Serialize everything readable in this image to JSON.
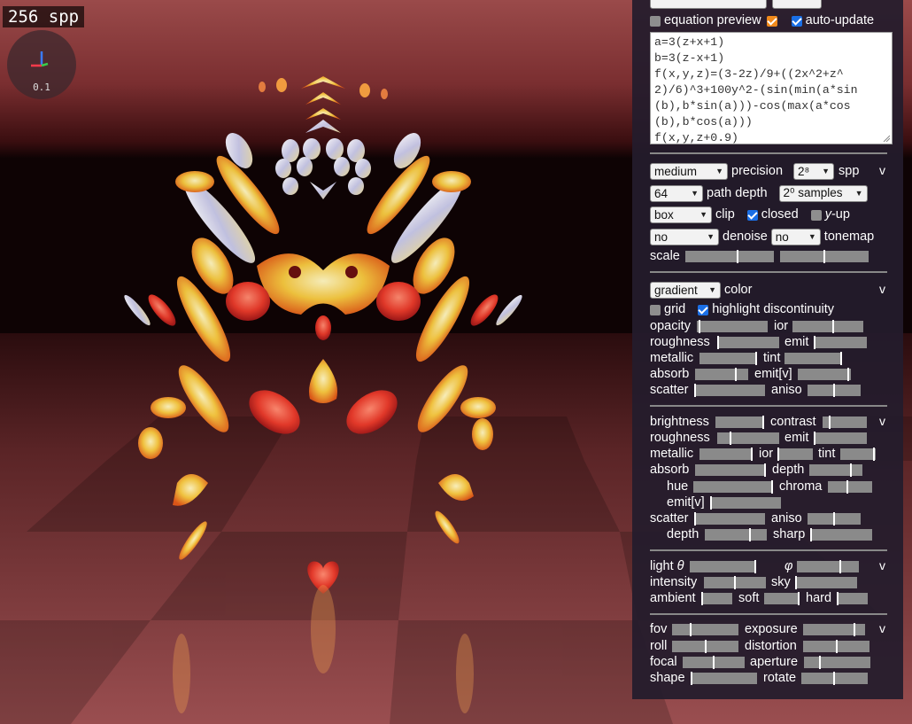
{
  "spp_display": "256 spp",
  "gizmo": {
    "scale": "0.1",
    "icon": "axis-gizmo-icon"
  },
  "colors": {
    "panel_bg": "#241c2c",
    "accent_checkbox": "#1a6fe6",
    "preview_checkbox": "#f08a1c",
    "slider_track": "#8a8a8a"
  },
  "panel": {
    "equation_preview_label": "equation preview",
    "auto_update_label": "auto-update",
    "equation_lines": [
      "a=3(z+x+1)",
      "b=3(z-x+1)",
      "f(x,y,z)=(3-2z)/9+((2x^2+z^",
      "2)/6)^3+100y^2-(sin(min(a*sin",
      "(b),b*sin(a)))-cos(max(a*cos",
      "(b),b*cos(a)))",
      "f(x,y,z+0.9)"
    ],
    "render": {
      "precision_value": "medium",
      "precision_label": "precision",
      "spp_value": "2⁸",
      "spp_label": "spp",
      "path_depth_value": "64",
      "path_depth_label": "path depth",
      "samples_value": "2⁰ samples",
      "clip_value": "box",
      "clip_label": "clip",
      "closed_label": "closed",
      "yup_label": "y",
      "yup_suffix": "-up",
      "denoise_value": "no",
      "denoise_label": "denoise",
      "tonemap_value": "no",
      "tonemap_label": "tonemap",
      "scale_label": "scale",
      "collapse": "v"
    },
    "material": {
      "color_value": "gradient",
      "color_label": "color",
      "grid_label": "grid",
      "highlight_label": "highlight discontinuity",
      "opacity": "opacity",
      "ior": "ior",
      "roughness": "roughness",
      "emit": "emit",
      "metallic": "metallic",
      "tint": "tint",
      "absorb": "absorb",
      "emit_v": "emit[v]",
      "scatter": "scatter",
      "aniso": "aniso",
      "collapse": "v"
    },
    "post": {
      "brightness": "brightness",
      "contrast": "contrast",
      "roughness": "roughness",
      "emit": "emit",
      "metallic": "metallic",
      "ior": "ior",
      "tint": "tint",
      "absorb": "absorb",
      "depth": "depth",
      "hue": "hue",
      "chroma": "chroma",
      "emit_v": "emit[v]",
      "scatter": "scatter",
      "aniso": "aniso",
      "depth2": "depth",
      "sharp": "sharp",
      "collapse": "v"
    },
    "light": {
      "light": "light",
      "theta": "θ",
      "phi": "φ",
      "intensity": "intensity",
      "sky": "sky",
      "ambient": "ambient",
      "soft": "soft",
      "hard": "hard",
      "collapse": "v"
    },
    "camera": {
      "fov": "fov",
      "exposure": "exposure",
      "roll": "roll",
      "distortion": "distortion",
      "focal": "focal",
      "aperture": "aperture",
      "shape": "shape",
      "rotate": "rotate",
      "collapse": "v"
    }
  },
  "slider_values": {
    "scale_1": 0.59,
    "scale_2": 0.5,
    "opacity": 0.02,
    "ior": 0.58,
    "roughness": 0.0,
    "emit": 0.0,
    "metallic": 1.0,
    "tint": 1.0,
    "absorb": 0.77,
    "emit_v": 0.97,
    "scatter": 0.0,
    "aniso": 0.5,
    "p_brightness": 1.0,
    "p_contrast": 0.15,
    "p_roughness": 0.21,
    "p_emit": 0.0,
    "p_metallic": 1.0,
    "p_ior": 0.0,
    "p_tint": 0.97,
    "p_absorb": 1.0,
    "p_depth": 0.79,
    "p_hue": 1.0,
    "p_chroma": 0.44,
    "p_emit_v": 0.0,
    "p_scatter": 0.0,
    "p_aniso": 0.5,
    "p_depth2": 0.73,
    "p_sharp": 0.0,
    "l_theta": 1.0,
    "l_phi": 0.7,
    "l_intensity": 0.5,
    "l_sky": 0.0,
    "l_ambient": 0.0,
    "l_soft": 1.0,
    "l_hard": 0.0,
    "c_fov": 0.27,
    "c_exposure": 0.84,
    "c_roll": 0.5,
    "c_distortion": 0.5,
    "c_focal": 0.5,
    "c_aperture": 0.23,
    "c_shape": 0.0,
    "c_rotate": 0.49
  }
}
